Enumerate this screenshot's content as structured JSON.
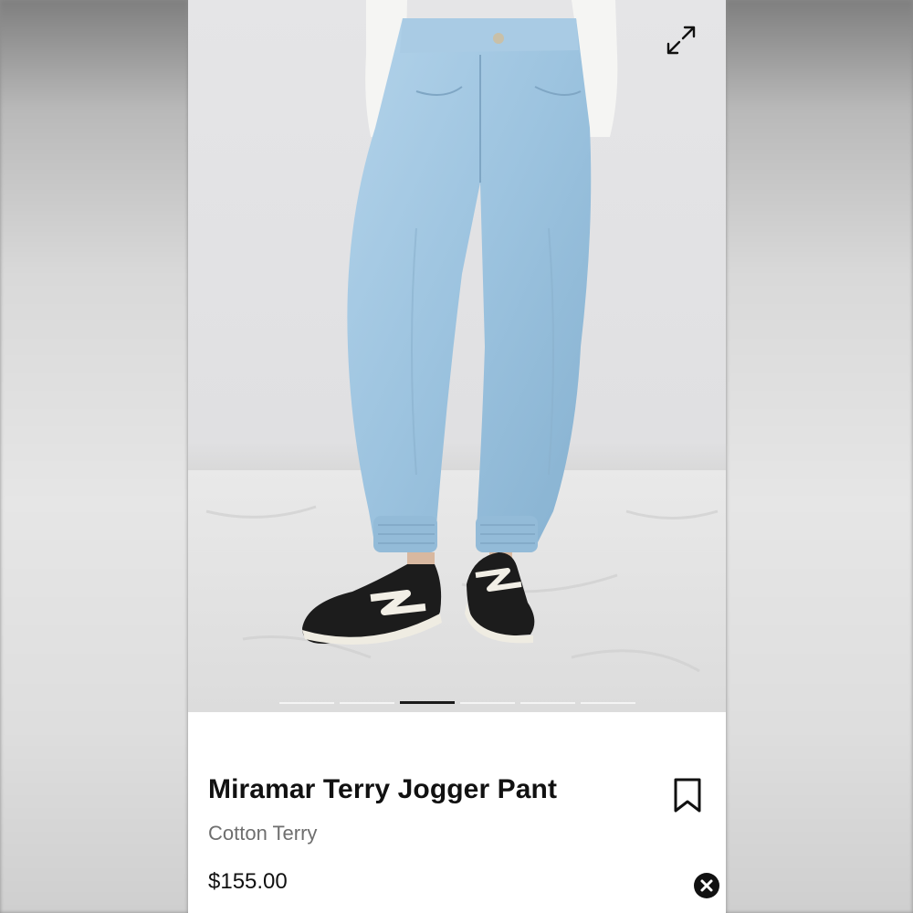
{
  "product": {
    "title": "Miramar Terry Jogger Pant",
    "subtitle": "Cotton Terry",
    "price": "$155.00"
  },
  "gallery": {
    "image_subject": "model-wearing-light-wash-denim-joggers-and-black-sneakers",
    "slide_count": 6,
    "active_slide": 3
  },
  "icons": {
    "expand": "expand-arrows-icon",
    "bookmark": "bookmark-icon",
    "close": "close-circle-icon"
  },
  "colors": {
    "text_primary": "#111111",
    "text_secondary": "#6e6e6e",
    "indicator_active": "#1a1a1a",
    "indicator_inactive": "#f4f4f4",
    "denim": "#9cc3df"
  }
}
